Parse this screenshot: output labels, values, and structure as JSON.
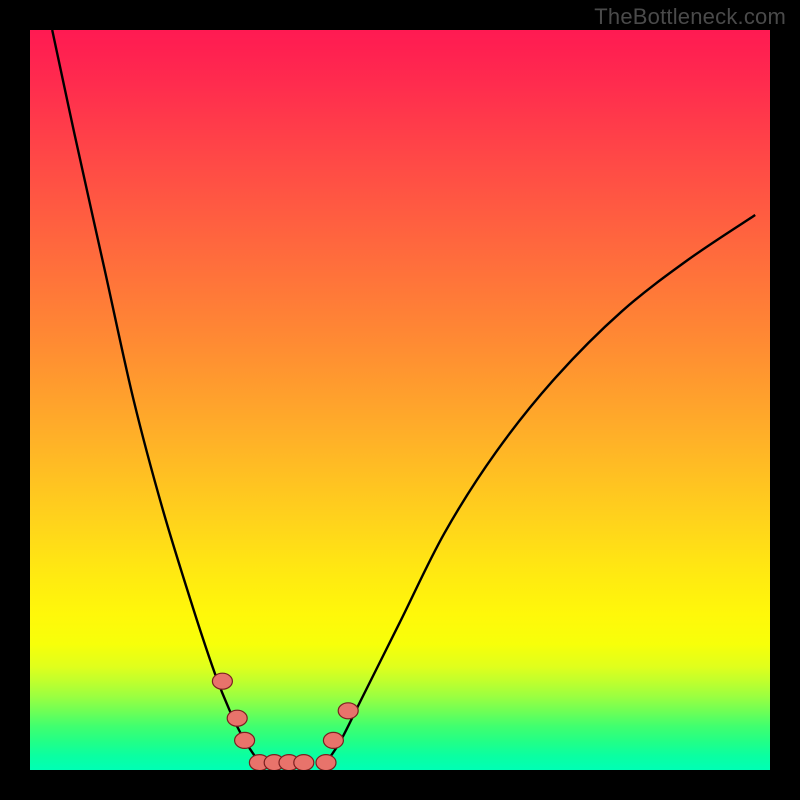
{
  "watermark": {
    "text": "TheBottleneck.com"
  },
  "chart_data": {
    "type": "line",
    "title": "",
    "xlabel": "",
    "ylabel": "",
    "xlim": [
      0,
      100
    ],
    "ylim": [
      0,
      100
    ],
    "grid": false,
    "legend": false,
    "background": "red-yellow-green vertical gradient",
    "series": [
      {
        "name": "left-curve",
        "x": [
          3,
          6,
          10,
          14,
          18,
          22,
          25,
          27,
          29,
          31
        ],
        "values": [
          100,
          86,
          68,
          50,
          35,
          22,
          13,
          8,
          4,
          1
        ]
      },
      {
        "name": "right-curve",
        "x": [
          40,
          42,
          45,
          50,
          56,
          63,
          71,
          80,
          89,
          98
        ],
        "values": [
          1,
          4,
          10,
          20,
          32,
          43,
          53,
          62,
          69,
          75
        ]
      },
      {
        "name": "markers",
        "x": [
          26,
          28,
          29,
          31,
          33,
          35,
          37,
          40,
          41,
          43
        ],
        "values": [
          12,
          7,
          4,
          1,
          1,
          1,
          1,
          1,
          4,
          8
        ]
      }
    ]
  }
}
